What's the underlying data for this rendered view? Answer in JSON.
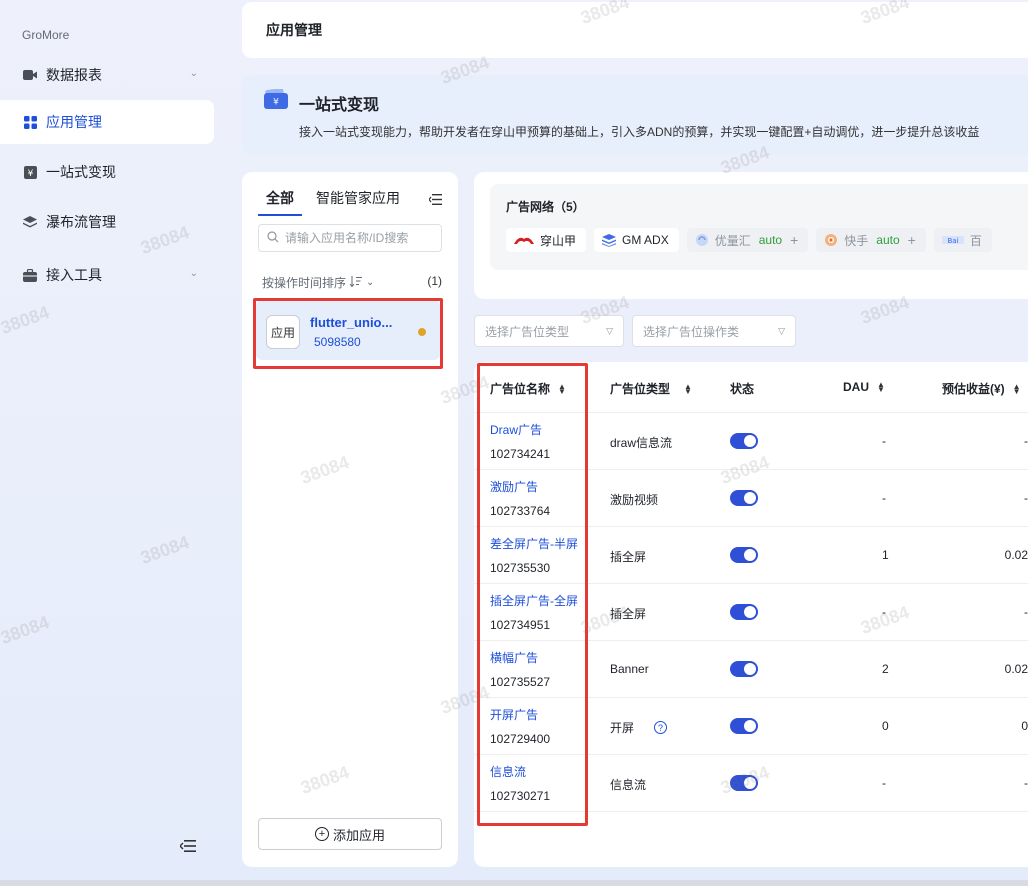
{
  "brand": "GroMore",
  "nav": [
    {
      "label": "数据报表",
      "icon": "video-icon",
      "chevron": true
    },
    {
      "label": "应用管理",
      "icon": "grid-icon",
      "active": true
    },
    {
      "label": "一站式变现",
      "icon": "yen-icon"
    },
    {
      "label": "瀑布流管理",
      "icon": "layers-icon"
    },
    {
      "label": "接入工具",
      "icon": "toolbox-icon",
      "chevron": true
    }
  ],
  "header": {
    "title": "应用管理"
  },
  "banner": {
    "title": "一站式变现",
    "desc": "接入一站式变现能力，帮助开发者在穿山甲预算的基础上，引入多ADN的预算，并实现一键配置+自动调优，进一步提升总该收益"
  },
  "app_panel": {
    "tabs": [
      "全部",
      "智能管家应用"
    ],
    "search_placeholder": "请输入应用名称/ID搜索",
    "sort_label": "按操作时间排序",
    "count": "(1)",
    "app": {
      "icon_text": "应用",
      "name": "flutter_unio...",
      "id": "5098580"
    },
    "add_label": "添加应用"
  },
  "network": {
    "title": "广告网络（5）",
    "chips": [
      {
        "name": "穿山甲",
        "icon": "pangle-icon"
      },
      {
        "name": "GM ADX",
        "icon": "gm-adx-icon"
      },
      {
        "name": "优量汇",
        "icon": "ylh-icon",
        "auto": "auto",
        "dim": true
      },
      {
        "name": "快手",
        "icon": "kuaishou-icon",
        "auto": "auto",
        "dim": true
      },
      {
        "name": "百",
        "icon": "baidu-icon",
        "dim": true
      }
    ]
  },
  "filters": {
    "type_placeholder": "选择广告位类型",
    "op_placeholder": "选择广告位操作类"
  },
  "table": {
    "headers": {
      "name": "广告位名称",
      "type": "广告位类型",
      "status": "状态",
      "dau": "DAU",
      "revenue": "预估收益(¥)"
    },
    "rows": [
      {
        "name": "Draw广告",
        "id": "102734241",
        "type": "draw信息流",
        "dau": "-",
        "revenue": "-"
      },
      {
        "name": "激励广告",
        "id": "102733764",
        "type": "激励视频",
        "dau": "-",
        "revenue": "-"
      },
      {
        "name": "差全屏广告-半屏",
        "id": "102735530",
        "type": "插全屏",
        "dau": "1",
        "revenue": "0.02"
      },
      {
        "name": "插全屏广告-全屏",
        "id": "102734951",
        "type": "插全屏",
        "dau": "-",
        "revenue": "-"
      },
      {
        "name": "横幅广告",
        "id": "102735527",
        "type": "Banner",
        "dau": "2",
        "revenue": "0.02"
      },
      {
        "name": "开屏广告",
        "id": "102729400",
        "type": "开屏",
        "dau": "0",
        "revenue": "0",
        "help": true
      },
      {
        "name": "信息流",
        "id": "102730271",
        "type": "信息流",
        "dau": "-",
        "revenue": "-"
      }
    ]
  },
  "watermark": "38084",
  "colors": {
    "accent": "#1e4fd8",
    "highlight": "#e53935",
    "toggle": "#2f4fd6",
    "auto": "#2e9e3a"
  }
}
